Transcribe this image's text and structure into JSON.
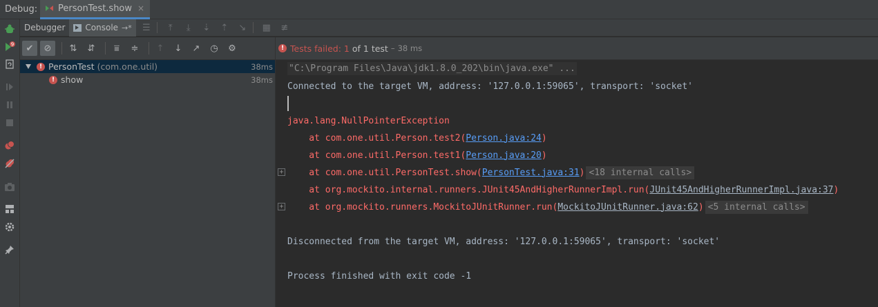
{
  "topbar": {
    "label": "Debug:",
    "tab_title": "PersonTest.show",
    "tab_close": "×"
  },
  "toolbar2": {
    "debugger_tab": "Debugger",
    "console_tab": "Console",
    "console_suffix": "→*"
  },
  "tree": {
    "root": {
      "name": "PersonTest",
      "package": "(com.one.util)",
      "time": "38ms"
    },
    "child": {
      "name": "show",
      "time": "38ms"
    }
  },
  "status": {
    "failed": "Tests failed: 1",
    "of": "of 1 test",
    "sep": "–",
    "duration": "38 ms"
  },
  "console": {
    "cmd": "\"C:\\Program Files\\Java\\jdk1.8.0_202\\bin\\java.exe\" ...",
    "connected": "Connected to the target VM, address: '127.0.0.1:59065', transport: 'socket'",
    "exception": "java.lang.NullPointerException",
    "frames": [
      {
        "prefix": "    at com.one.util.Person.test2(",
        "link": "Person.java:24",
        "suffix": ")",
        "internal": ""
      },
      {
        "prefix": "    at com.one.util.Person.test1(",
        "link": "Person.java:20",
        "suffix": ")",
        "internal": ""
      },
      {
        "prefix": "    at com.one.util.PersonTest.show(",
        "link": "PersonTest.java:31",
        "suffix": ")",
        "internal": "<18 internal calls>"
      },
      {
        "prefix": "    at org.mockito.internal.runners.JUnit45AndHigherRunnerImpl.run(",
        "link": "JUnit45AndHigherRunnerImpl.java:37",
        "suffix": ")",
        "internal": ""
      },
      {
        "prefix": "    at org.mockito.runners.MockitoJUnitRunner.run(",
        "link": "MockitoJUnitRunner.java:62",
        "suffix": ")",
        "internal": "<5 internal calls>"
      }
    ],
    "disconnected": "Disconnected from the target VM, address: '127.0.0.1:59065', transport: 'socket'",
    "finished": "Process finished with exit code -1"
  },
  "colors": {
    "error": "#c75450",
    "link": "#589df6",
    "exception": "#ff6b68",
    "selection": "#0d293e"
  }
}
